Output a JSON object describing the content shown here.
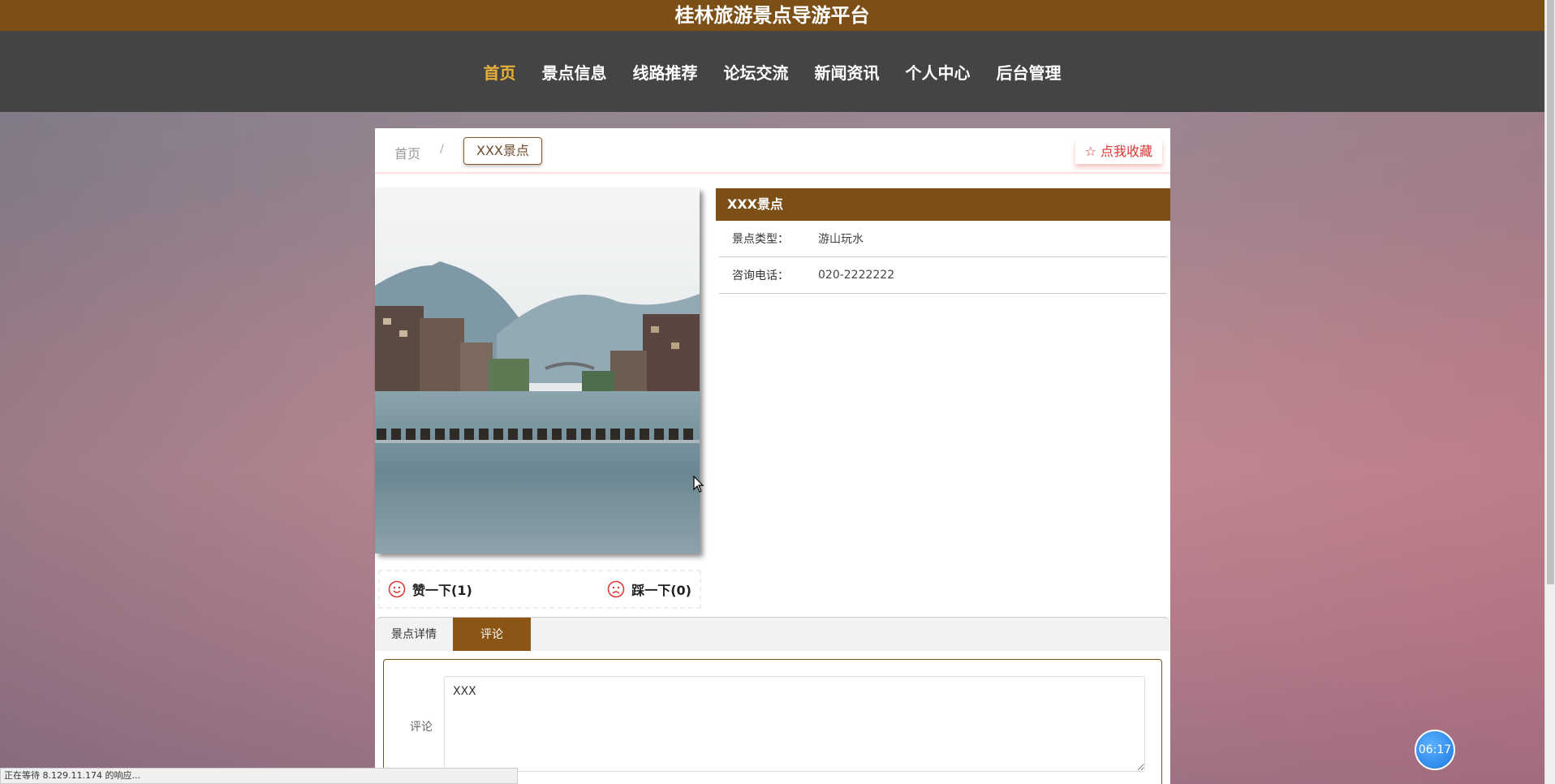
{
  "site": {
    "title": "桂林旅游景点导游平台"
  },
  "nav": [
    {
      "label": "首页",
      "active": true
    },
    {
      "label": "景点信息"
    },
    {
      "label": "线路推荐"
    },
    {
      "label": "论坛交流"
    },
    {
      "label": "新闻资讯"
    },
    {
      "label": "个人中心"
    },
    {
      "label": "后台管理"
    }
  ],
  "breadcrumb": {
    "home": "首页",
    "separator": "/",
    "current": "XXX景点"
  },
  "favorite": {
    "label": "☆ 点我收藏"
  },
  "votes": {
    "like_label": "赞一下(1)",
    "dislike_label": "踩一下(0)"
  },
  "detail": {
    "title": "XXX景点",
    "rows": [
      {
        "key": "景点类型：",
        "value": "游山玩水"
      },
      {
        "key": "咨询电话：",
        "value": "020-2222222"
      }
    ]
  },
  "tabs": [
    {
      "label": "景点详情"
    },
    {
      "label": "评论",
      "active": true
    }
  ],
  "comment": {
    "label": "评论",
    "value": "XXX"
  },
  "status": {
    "text": "正在等待 8.129.11.174 的响应..."
  },
  "timer": {
    "text": "06:17"
  },
  "colors": {
    "brand": "#7c4f17",
    "nav_bg": "#444444",
    "nav_active": "#e8b23a",
    "favorite": "#dd3333"
  }
}
